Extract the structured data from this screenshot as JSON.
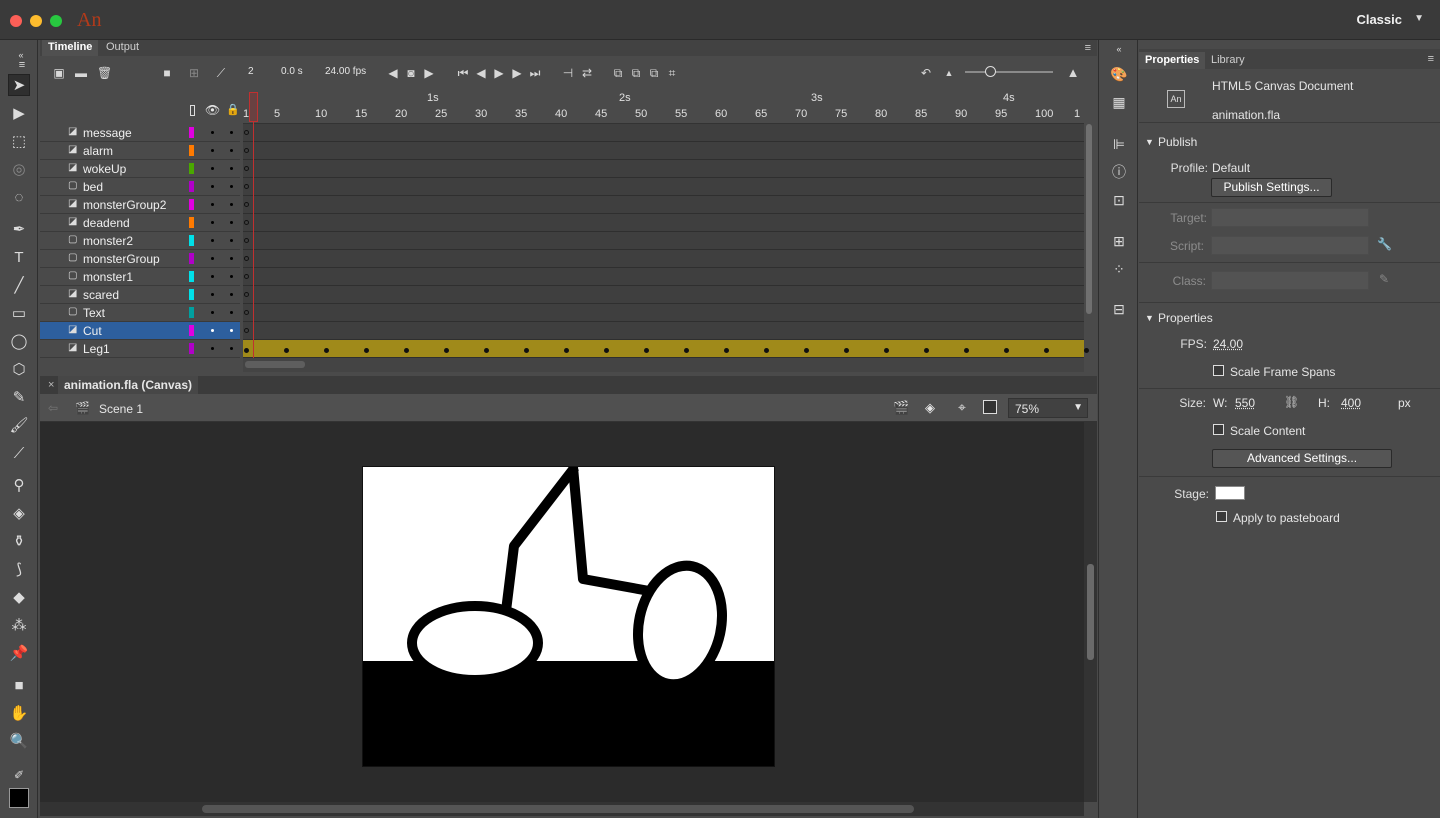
{
  "app": {
    "logo": "An",
    "workspace": "Classic"
  },
  "tabs": {
    "timeline": "Timeline",
    "output": "Output"
  },
  "timeline": {
    "current_frame": "2",
    "time": "0.0 s",
    "fps": "24.00 fps",
    "ruler_seconds": [
      "1s",
      "2s",
      "3s",
      "4s"
    ],
    "ruler_frames": [
      "1",
      "5",
      "10",
      "15",
      "20",
      "25",
      "30",
      "35",
      "40",
      "45",
      "50",
      "55",
      "60",
      "65",
      "70",
      "75",
      "80",
      "85",
      "90",
      "95",
      "100",
      "1"
    ],
    "layers": [
      {
        "name": "message",
        "type": "movieclip",
        "color": "#e000e0"
      },
      {
        "name": "alarm",
        "type": "movieclip",
        "color": "#ff7a00"
      },
      {
        "name": "wokeUp",
        "type": "movieclip",
        "color": "#4aa800"
      },
      {
        "name": "bed",
        "type": "folder",
        "color": "#b000c8"
      },
      {
        "name": "monsterGroup2",
        "type": "movieclip",
        "color": "#e000e0"
      },
      {
        "name": "deadend",
        "type": "movieclip",
        "color": "#ff7a00"
      },
      {
        "name": "monster2",
        "type": "folder",
        "color": "#00e0e8"
      },
      {
        "name": "monsterGroup",
        "type": "folder",
        "color": "#b000c8"
      },
      {
        "name": "monster1",
        "type": "folder",
        "color": "#00e0e8"
      },
      {
        "name": "scared",
        "type": "movieclip",
        "color": "#00e0e8"
      },
      {
        "name": "Text",
        "type": "folder",
        "color": "#00a0a0"
      },
      {
        "name": "Cut",
        "type": "movieclip",
        "color": "#e000e0",
        "selected": true
      },
      {
        "name": "Leg1",
        "type": "movieclip",
        "color": "#b000c8",
        "tween": true
      }
    ]
  },
  "document_tab": {
    "title": "animation.fla (Canvas)",
    "close_icon": "×"
  },
  "stage": {
    "scene": "Scene 1",
    "zoom": "75%"
  },
  "properties_tabs": {
    "properties": "Properties",
    "library": "Library"
  },
  "properties": {
    "doc_type": "HTML5 Canvas Document",
    "doc_name": "animation.fla",
    "publish": {
      "section": "Publish",
      "profile_label": "Profile:",
      "profile_value": "Default",
      "settings_button": "Publish Settings...",
      "target_label": "Target:",
      "script_label": "Script:",
      "class_label": "Class:"
    },
    "props": {
      "section": "Properties",
      "fps_label": "FPS:",
      "fps_value": "24.00",
      "scale_frame_spans": "Scale Frame Spans",
      "size_label": "Size:",
      "w_label": "W:",
      "w_value": "550",
      "h_label": "H:",
      "h_value": "400",
      "unit": "px",
      "scale_content": "Scale Content",
      "advanced_button": "Advanced Settings...",
      "stage_label": "Stage:",
      "stage_color": "#ffffff",
      "apply_pasteboard": "Apply to pasteboard"
    }
  }
}
